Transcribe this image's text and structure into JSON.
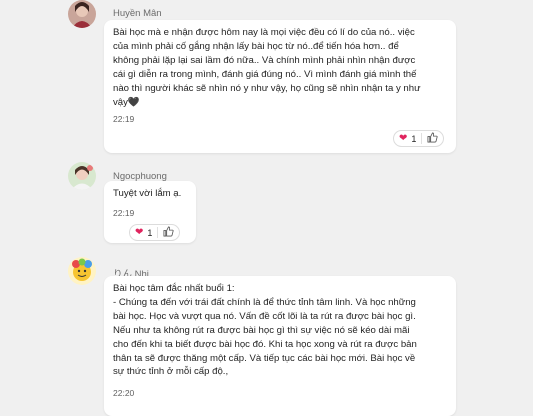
{
  "messages": [
    {
      "sender": "Huyền Mân",
      "lines": [
        "Bài học mà e nhận được hôm nay là mọi việc đều có lí do của nó.. việc",
        "của mình phải cố gắng nhận lấy bài học từ nó..để tiến hóa hơn.. để",
        "không phải lặp lại sai lầm đó nữa.. Và chính mình phải nhìn nhận được",
        "cái gì diễn ra trong mình, đánh giá đúng nó.. Vì mình đánh giá mình thế",
        "nào thì người khác sẽ nhìn nó y như vậy, họ cũng sẽ nhìn nhận ta y như",
        "vậy🖤"
      ],
      "time": "22:19",
      "reaction": {
        "emoji": "❤️",
        "count": "1"
      }
    },
    {
      "sender": "Ngocphuong",
      "lines": [
        "Tuyệt vời lắm ạ."
      ],
      "time": "22:19",
      "reaction": {
        "emoji": "❤️",
        "count": "1"
      }
    },
    {
      "sender": "りん Nhi",
      "lines": [
        "Bài học tâm đắc nhất buổi 1:",
        "- Chúng ta đến với trái đất chính là để thức tỉnh tâm linh. Và học những",
        "bài học. Học và vượt qua nó. Vấn đề cốt lõi là ta rút ra được bài học gì.",
        "Nếu như ta không rút ra được bài học gì thì sự việc nó sẽ kéo dài mãi",
        "cho đến khi ta biết được bài học đó. Khi ta học xong và rút ra được bản",
        "thân ta sẽ được thăng một cấp. Và tiếp tục các bài học mới. Bài học về",
        "sự thức tỉnh ở mỗi cấp độ.,"
      ],
      "time": "22:20"
    }
  ],
  "icons": {
    "like": "thumbs-up-icon",
    "heart": "heart-icon"
  },
  "colors": {
    "background": "#f0f0f0",
    "bubble": "#ffffff",
    "heart": "#e0245e"
  }
}
